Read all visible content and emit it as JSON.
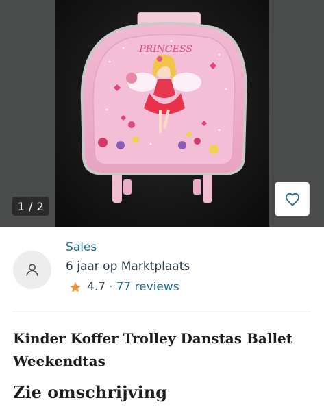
{
  "gallery": {
    "counter": "1 / 2",
    "image_print": "PRINCESS"
  },
  "seller": {
    "name": "Sales",
    "years": "6 jaar op Marktplaats",
    "rating": "4.7",
    "separator": "·",
    "reviews": "77 reviews",
    "star_color": "#e8973e"
  },
  "listing": {
    "title": "Kinder Koffer Trolley Danstas Ballet Weekendtas",
    "description_heading": "Zie omschrijving"
  },
  "colors": {
    "link": "#1f6d8e",
    "text": "#2d3c4d",
    "favorite_icon": "#1f6d8e"
  },
  "icons": {
    "favorite": "heart-outline-icon",
    "avatar": "user-icon",
    "rating": "star-icon"
  }
}
